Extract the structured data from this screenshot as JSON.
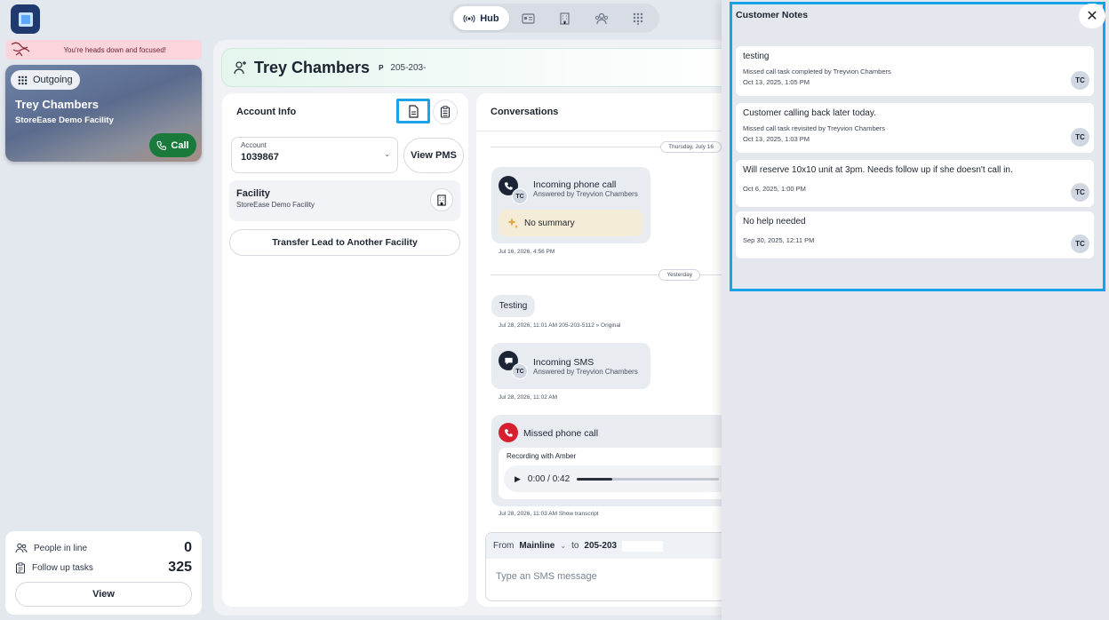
{
  "topnav": {
    "hub_label": "Hub"
  },
  "focus": {
    "message": "You're heads down and focused!"
  },
  "outgoing": {
    "chip_label": "Outgoing",
    "name": "Trey Chambers",
    "facility": "StoreEase Demo Facility",
    "call_label": "Call"
  },
  "queue": {
    "people_label": "People in line",
    "people_count": "0",
    "tasks_label": "Follow up tasks",
    "tasks_count": "325",
    "view_label": "View"
  },
  "lead": {
    "name": "Trey Chambers",
    "badge": "P",
    "phone": "205-203-"
  },
  "account": {
    "title": "Account Info",
    "select_label": "Account",
    "select_value": "1039867",
    "view_pms": "View PMS",
    "facility_title": "Facility",
    "facility_name": "StoreEase Demo Facility",
    "transfer_label": "Transfer Lead to Another Facility"
  },
  "conversations": {
    "title": "Conversations",
    "day1": "Thursday, July 16",
    "call1": {
      "title": "Incoming phone call",
      "sub": "Answered by Treyvion Chambers",
      "summary": "No summary",
      "initials": "TC",
      "meta": "Jul 16, 2026, 4:56 PM"
    },
    "day2": "Yesterday",
    "sms_text": "Testing",
    "sms_meta": "Jul 28, 2026, 11:01 AM  205-203-5112 » Original",
    "sms2": {
      "title": "Incoming SMS",
      "sub": "Answered by Treyvion Chambers",
      "initials": "TC",
      "meta": "Jul 28, 2026, 11:02 AM"
    },
    "missed": {
      "title": "Missed phone call",
      "recording": "Recording with Amber",
      "time": "0:00 / 0:42",
      "meta": "Jul 28, 2026, 11:03 AM  Show transcript"
    },
    "compose": {
      "from_label": "From",
      "from_value": "Mainline",
      "to_label": "to",
      "to_value": "205-203",
      "placeholder": "Type an SMS message"
    }
  },
  "notes": {
    "title": "Customer Notes",
    "items": [
      {
        "title": "testing",
        "sub": "Missed call task completed by Treyvion Chambers",
        "date": "Oct 13, 2025, 1:05 PM",
        "initials": "TC"
      },
      {
        "title": "Customer calling back later today.",
        "sub": "Missed call task revisited by Treyvion Chambers",
        "date": "Oct 13, 2025, 1:03 PM",
        "initials": "TC"
      },
      {
        "title": "Will reserve 10x10 unit at 3pm. Needs follow up if she doesn't call in.",
        "sub": "",
        "date": "Oct 6, 2025, 1:00 PM",
        "initials": "TC"
      },
      {
        "title": "No help needed",
        "sub": "",
        "date": "Sep 30, 2025, 12:11 PM",
        "initials": "TC"
      }
    ]
  }
}
